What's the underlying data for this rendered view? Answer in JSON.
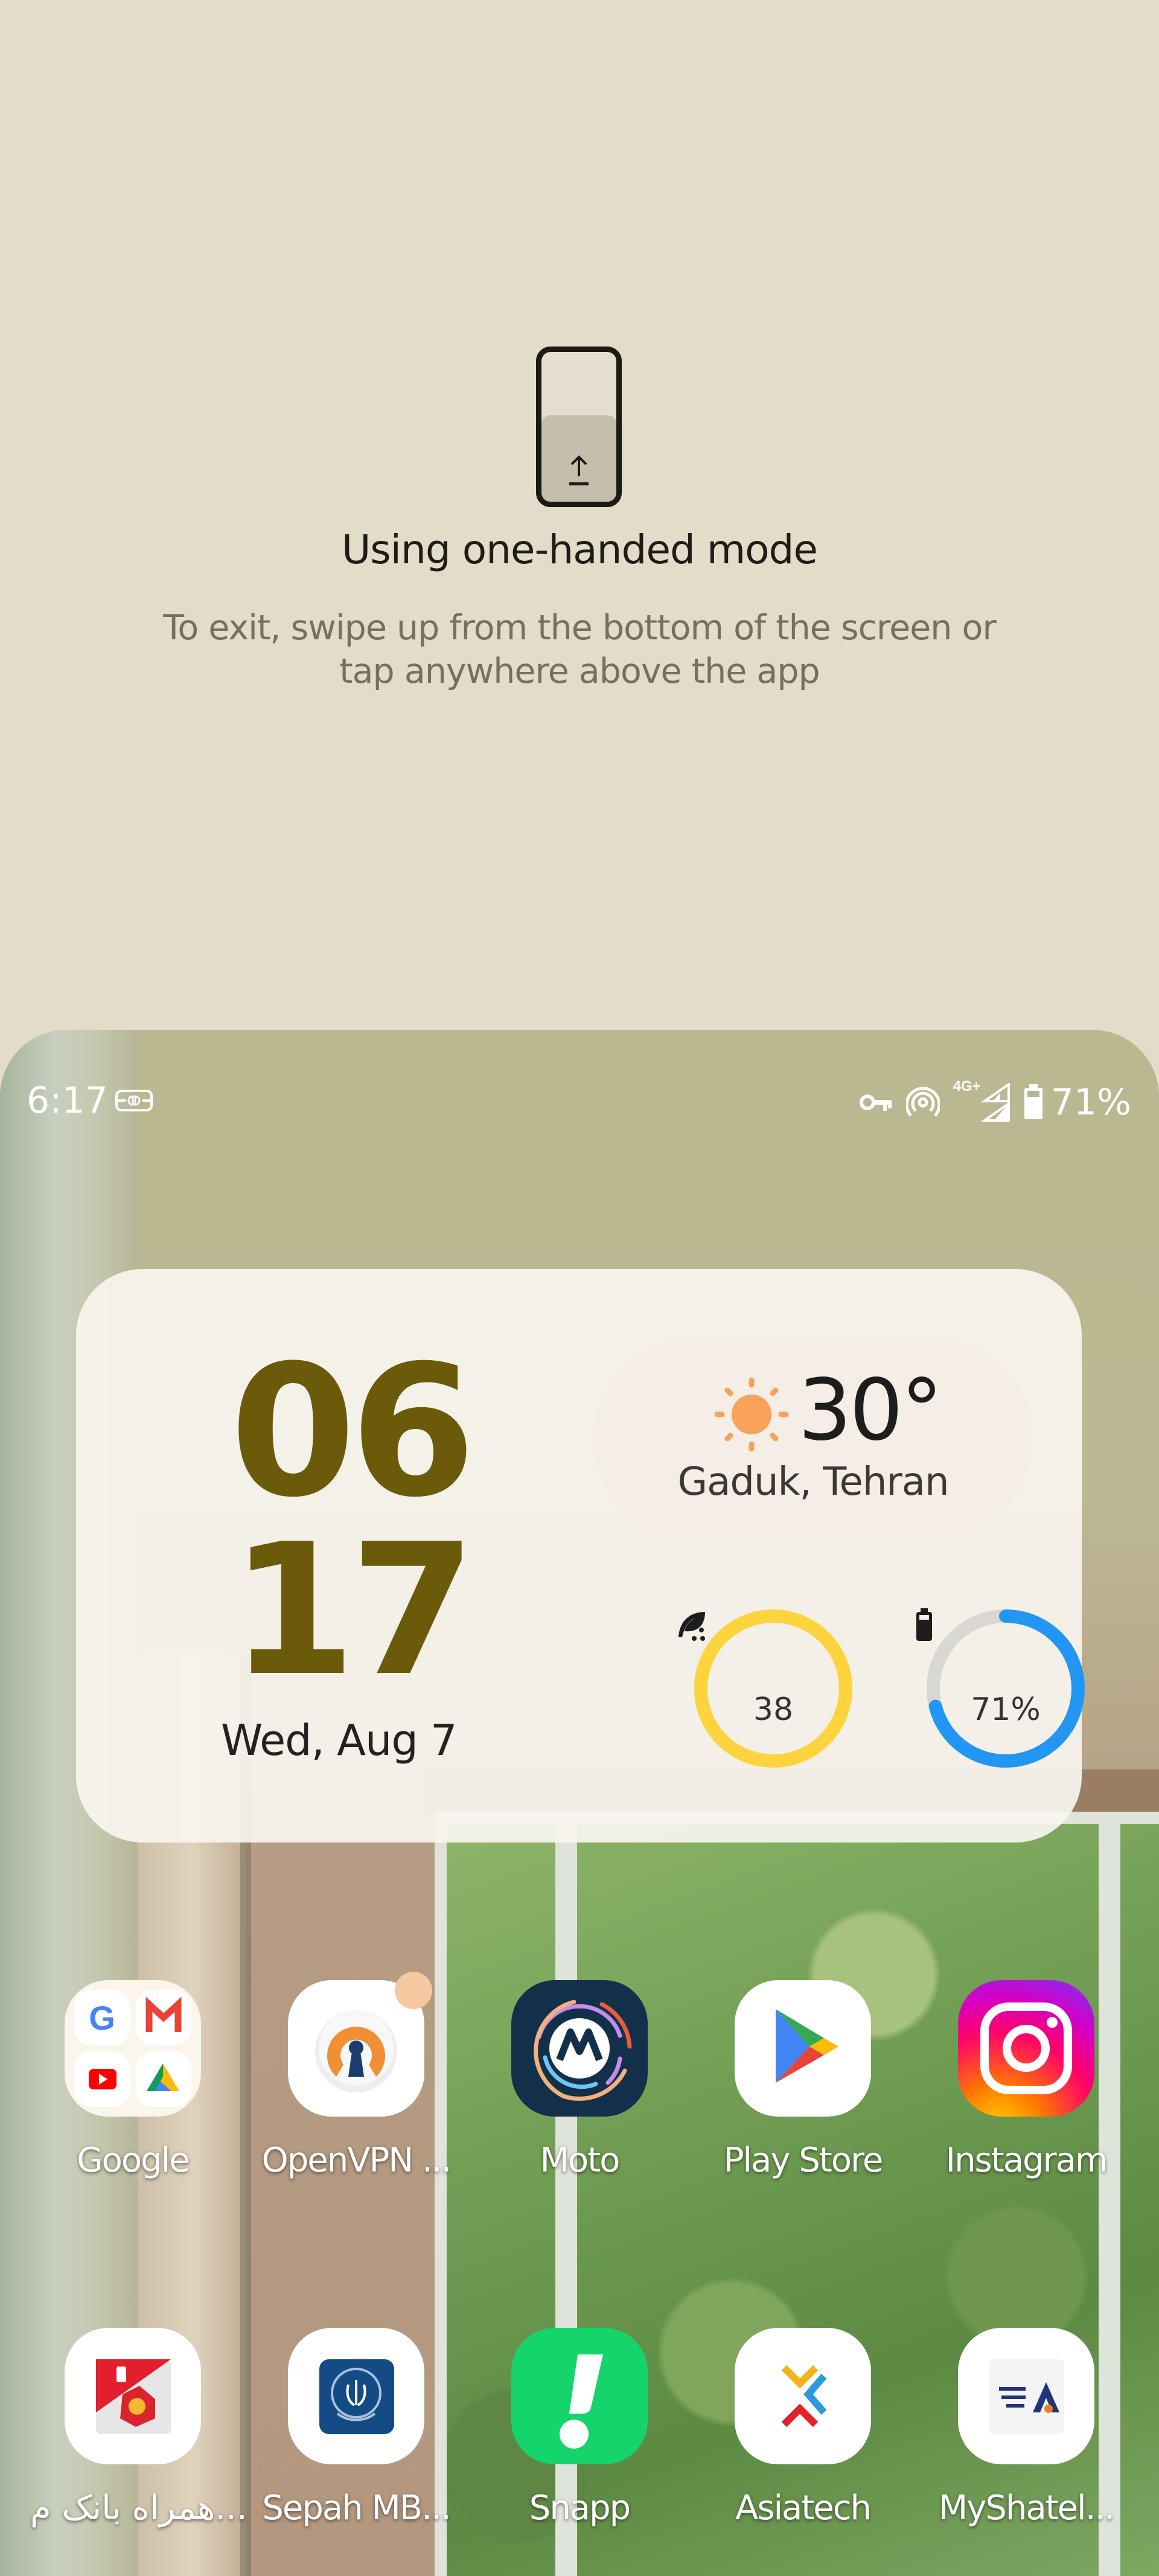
{
  "one_handed_hint": {
    "icon": "one-handed-mode-icon",
    "title": "Using one-handed mode",
    "body": "To exit, swipe up from the bottom of the screen or tap anywhere above the app"
  },
  "status_bar": {
    "time": "6:17",
    "left_icons": [
      "vpn-connector-icon"
    ],
    "right_icons": [
      "vpn-key-icon",
      "hotspot-icon",
      "signal-icon",
      "battery-icon"
    ],
    "network": "4G+",
    "battery": "71%"
  },
  "widget": {
    "clock_hour": "06",
    "clock_minute": "17",
    "date": "Wed, Aug 7",
    "weather": {
      "icon": "sun-icon",
      "temperature": "30°",
      "location": "Gaduk, Tehran"
    },
    "air_quality": {
      "icon": "leaf-icon",
      "value": "38",
      "ring_fraction": 1.0,
      "color": "#fdd43d"
    },
    "battery": {
      "icon": "battery-icon",
      "value": "71%",
      "fraction": 0.71,
      "color": "#2196f3",
      "track_color": "#d9d7d2"
    },
    "clock_color": "#6b5a0a"
  },
  "apps": [
    {
      "label": "Google",
      "icon": "google-folder-icon",
      "badge": false
    },
    {
      "label": "OpenVPN ...",
      "icon": "openvpn-icon",
      "badge": true
    },
    {
      "label": "Moto",
      "icon": "moto-icon",
      "badge": false
    },
    {
      "label": "Play Store",
      "icon": "play-store-icon",
      "badge": false
    },
    {
      "label": "Instagram",
      "icon": "instagram-icon",
      "badge": false
    },
    {
      "label": "همراه بانک م...",
      "icon": "mellat-bank-icon",
      "badge": false
    },
    {
      "label": "Sepah MB...",
      "icon": "sepah-bank-icon",
      "badge": false
    },
    {
      "label": "Snapp",
      "icon": "snapp-icon",
      "badge": false
    },
    {
      "label": "Asiatech",
      "icon": "asiatech-icon",
      "badge": false
    },
    {
      "label": "MyShatel...",
      "icon": "myshatel-icon",
      "badge": false
    }
  ]
}
